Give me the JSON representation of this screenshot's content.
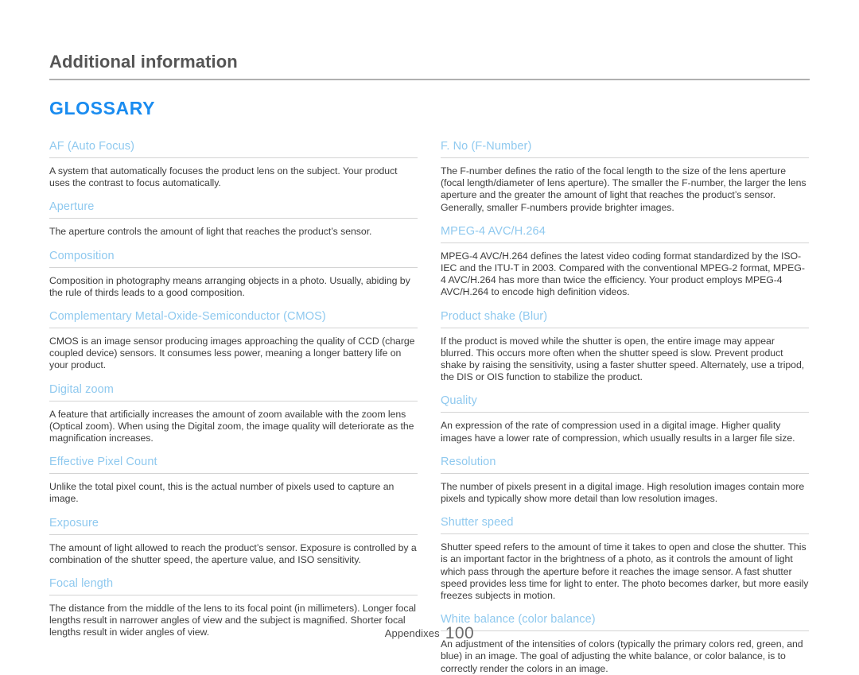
{
  "header": {
    "chapter_title": "Additional information",
    "section_title": "GLOSSARY"
  },
  "colors": {
    "section_accent": "#1a8cf0",
    "term_accent": "#8fc9ef",
    "body_text": "#3c3c3c",
    "chapter_text": "#555555",
    "rule": "#d4d4d4",
    "header_rule": "#b0b0b0"
  },
  "left_column": {
    "entries": [
      {
        "term": "AF (Auto Focus)",
        "definition": "A system that automatically focuses the product lens on the subject. Your product uses the contrast to focus automatically."
      },
      {
        "term": "Aperture",
        "definition": "The aperture controls the amount of light that reaches the product’s sensor."
      },
      {
        "term": "Composition",
        "definition": "Composition in photography means arranging objects in a photo. Usually, abiding by the rule of thirds leads to a good composition."
      },
      {
        "term": "Complementary Metal-Oxide-Semiconductor (CMOS)",
        "definition": "CMOS is an image sensor producing images approaching the quality of CCD (charge coupled device) sensors. It consumes less power, meaning a longer battery life on your product."
      },
      {
        "term": "Digital zoom",
        "definition": "A feature that artificially increases the amount of zoom available with the zoom lens (Optical zoom). When using the Digital zoom, the image quality will deteriorate as the magnification increases."
      },
      {
        "term": "Effective Pixel Count",
        "definition": "Unlike the total pixel count, this is the actual number of pixels used to capture an image."
      },
      {
        "term": "Exposure",
        "definition": "The amount of light allowed to reach the product’s sensor. Exposure is controlled by a combination of the shutter speed, the aperture value, and ISO sensitivity."
      },
      {
        "term": "Focal length",
        "definition": "The distance from the middle of the lens to its focal point (in millimeters). Longer focal lengths result in narrower angles of view and the subject is magnified. Shorter focal lengths result in wider angles of view."
      }
    ]
  },
  "right_column": {
    "entries": [
      {
        "term": "F. No (F-Number)",
        "definition": "The F-number defines the ratio of the focal length to the size of the lens aperture (focal length/diameter of lens aperture). The smaller the F-number, the larger the lens aperture and the greater the amount of light that reaches the product’s sensor. Generally, smaller F-numbers provide brighter images."
      },
      {
        "term": "MPEG-4 AVC/H.264",
        "definition": "MPEG-4 AVC/H.264 defines the latest video coding format standardized by the ISO-IEC and the ITU-T in 2003. Compared with the conventional MPEG-2 format, MPEG-4 AVC/H.264 has more than twice the efficiency. Your product employs MPEG-4 AVC/H.264 to encode high definition videos."
      },
      {
        "term": "Product shake (Blur)",
        "definition": "If the product is moved while the shutter is open, the entire image may appear blurred. This occurs more often when the shutter speed is slow. Prevent product shake by raising the sensitivity, using a faster shutter speed. Alternately, use a tripod, the DIS or OIS function to stabilize the product."
      },
      {
        "term": "Quality",
        "definition": "An expression of the rate of compression used in a digital image. Higher quality images have a lower rate of compression, which usually results in a larger file size."
      },
      {
        "term": "Resolution",
        "definition": "The number of pixels present in a digital image. High resolution images contain more pixels and typically show more detail than low resolution images."
      },
      {
        "term": "Shutter speed",
        "definition": "Shutter speed refers to the amount of time it takes to open and close the shutter. This is an important factor in the brightness of a photo, as it controls the amount of light which pass through the aperture before it reaches the image sensor. A fast shutter speed provides less time for light to enter. The photo becomes darker, but more easily freezes subjects in motion."
      },
      {
        "term": "White balance (color balance)",
        "definition": "An adjustment of the intensities of colors (typically the primary colors red, green, and blue) in an image. The goal of adjusting the white balance, or color balance, is to correctly render the colors in an image."
      }
    ]
  },
  "footer": {
    "label": "Appendixes",
    "page_number": "100"
  }
}
